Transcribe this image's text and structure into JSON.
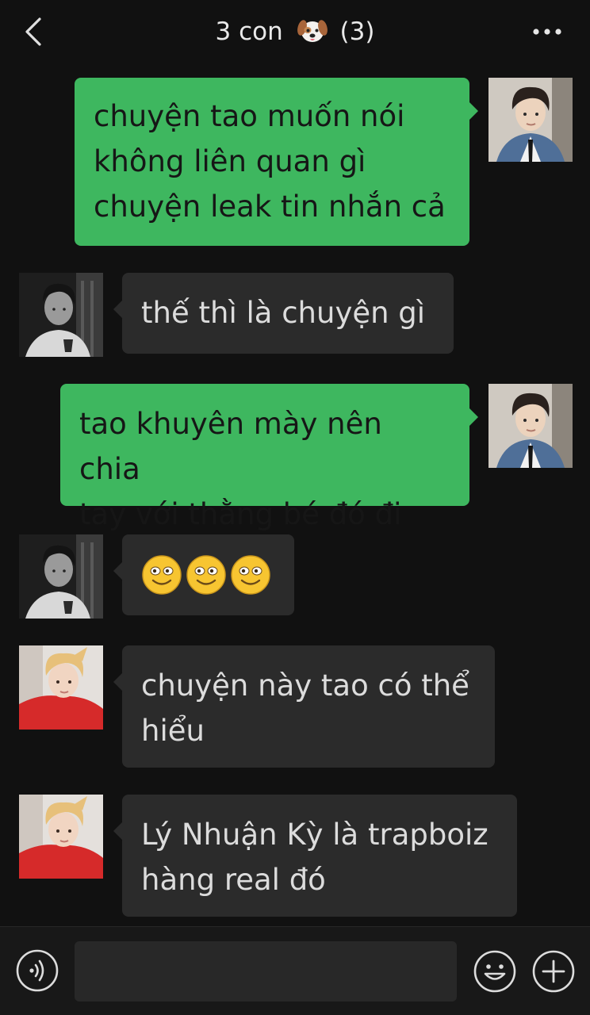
{
  "header": {
    "title": "3 con",
    "title_emoji_icon": "dog-face-icon",
    "member_count": "(3)",
    "back_icon": "chevron-left-icon",
    "more_icon": "more-dots-icon"
  },
  "messages": [
    {
      "direction": "outgoing",
      "avatar": "avatar-boy-denim-jacket",
      "lines": [
        "chuyện tao muốn nói",
        "không liên quan gì",
        "chuyện leak tin nhắn cả"
      ]
    },
    {
      "direction": "incoming",
      "avatar": "avatar-boy-dark-photo",
      "lines": [
        "thế thì là chuyện gì"
      ]
    },
    {
      "direction": "outgoing",
      "avatar": "avatar-boy-denim-jacket",
      "lines": [
        "tao khuyên mày nên chia",
        "tay với thằng bé đó đi"
      ]
    },
    {
      "direction": "incoming",
      "avatar": "avatar-boy-dark-photo",
      "emojis": [
        "smile-icon",
        "smile-icon",
        "smile-icon"
      ]
    },
    {
      "direction": "incoming",
      "avatar": "avatar-boy-red-hoodie",
      "lines": [
        "chuyện này tao có thể",
        "hiểu"
      ]
    },
    {
      "direction": "incoming",
      "avatar": "avatar-boy-red-hoodie",
      "lines": [
        "Lý Nhuận Kỳ là trapboiz",
        "hàng real đó"
      ]
    }
  ],
  "toolbar": {
    "voice_icon": "voice-input-icon",
    "input_value": "",
    "emoji_icon": "emoji-face-icon",
    "plus_icon": "plus-circle-icon"
  },
  "colors": {
    "background": "#111111",
    "outgoing_bubble": "#3eb75f",
    "incoming_bubble": "#2b2b2b",
    "incoming_text": "#dcdcdc",
    "outgoing_text": "#161616"
  }
}
